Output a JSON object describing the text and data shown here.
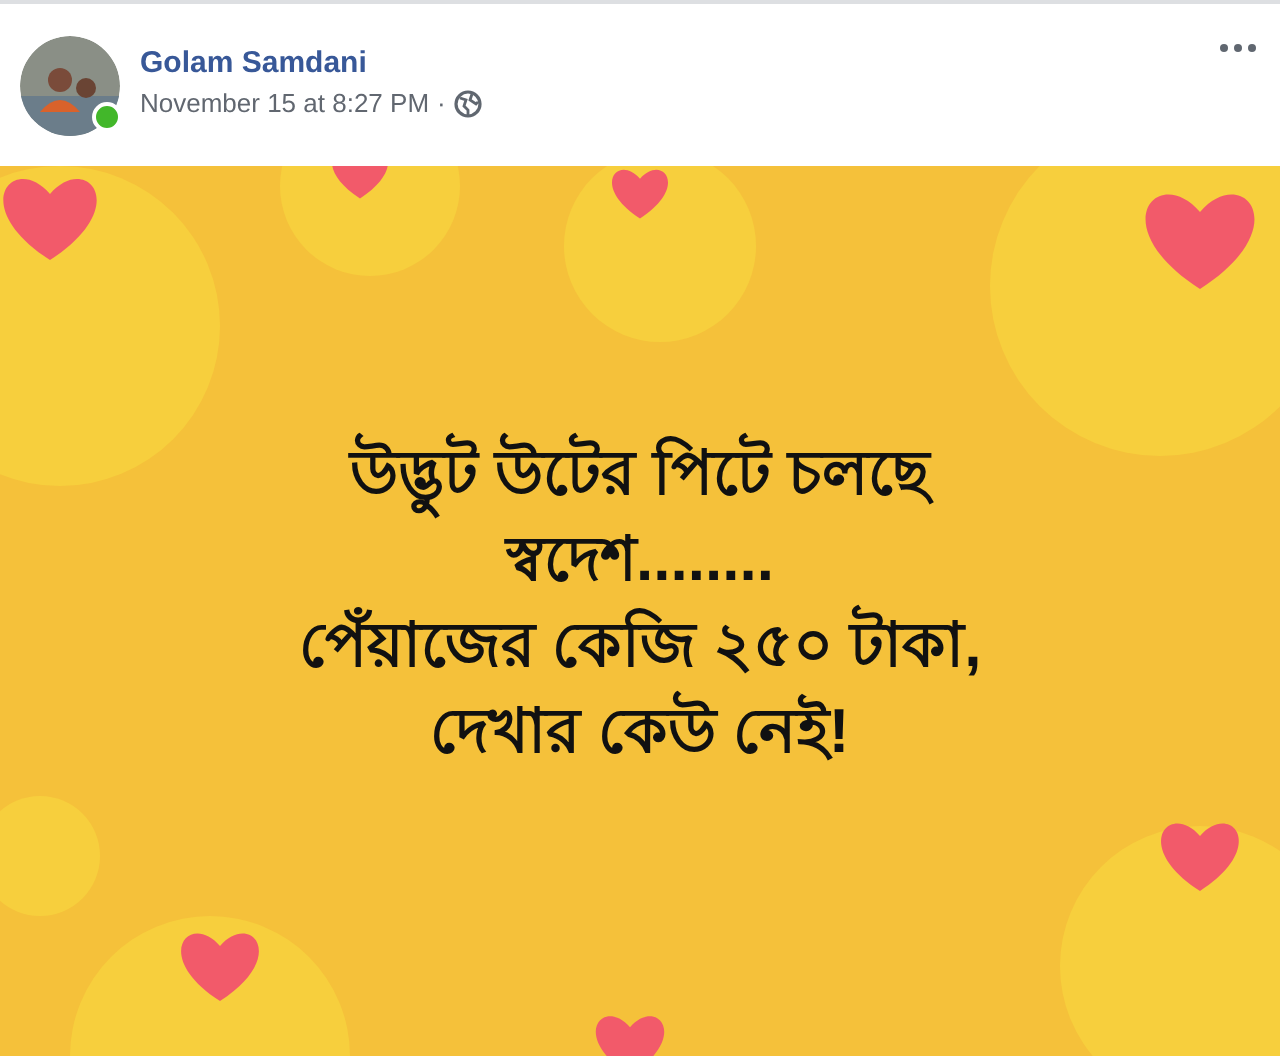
{
  "post": {
    "author": "Golam Samdani",
    "online": true,
    "timestamp": "November 15 at 8:27 PM",
    "separator": "·",
    "image": {
      "kind": "picture",
      "caption_lines": [
        "উদ্ভুট উটের পিটে চলছে",
        "স্বদেশ........",
        "পেঁয়াজের কেজি ২৫০ টাকা,",
        "দেখার কেউ নেই!"
      ]
    }
  }
}
